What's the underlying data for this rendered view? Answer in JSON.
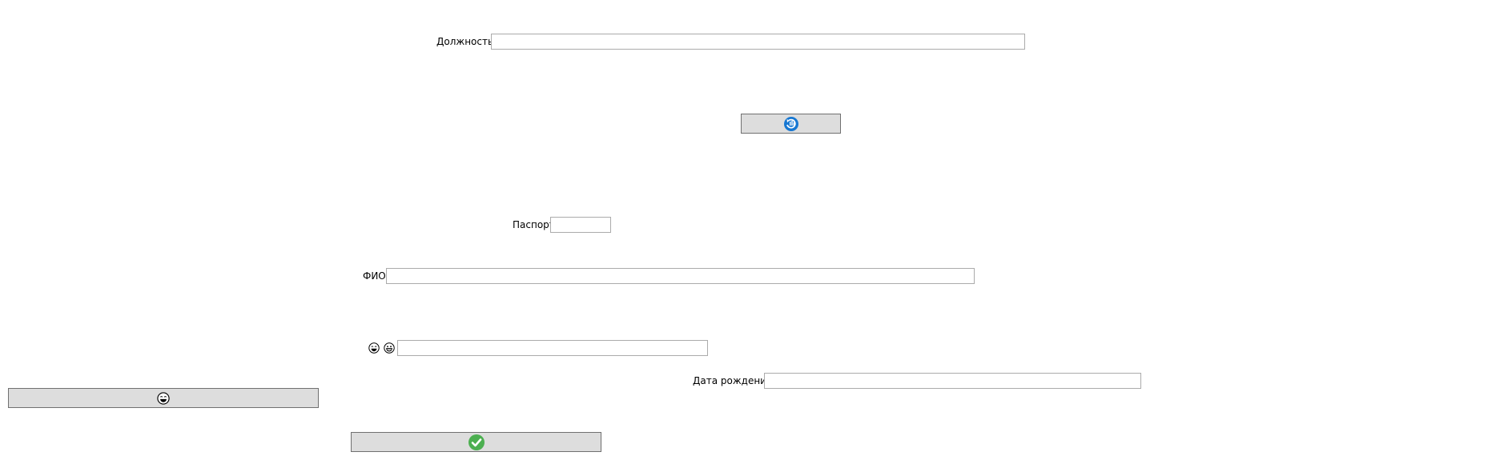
{
  "form": {
    "position": {
      "label": "Должность",
      "value": ""
    },
    "passport": {
      "label": "Паспорт",
      "value": ""
    },
    "full_name": {
      "label": "ФИО",
      "value": ""
    },
    "emoji_field": {
      "value": ""
    },
    "birth_date": {
      "label": "Дата рождения",
      "value": ""
    }
  },
  "icons": {
    "refresh_button": "refresh-icon",
    "emoji_button": "emoji-face-icon",
    "confirm_button": "checkmark-icon"
  },
  "colors": {
    "refresh_blue": "#1677d2",
    "confirm_green": "#4caf50",
    "button_bg": "#dddddd",
    "input_border": "#ababab"
  }
}
